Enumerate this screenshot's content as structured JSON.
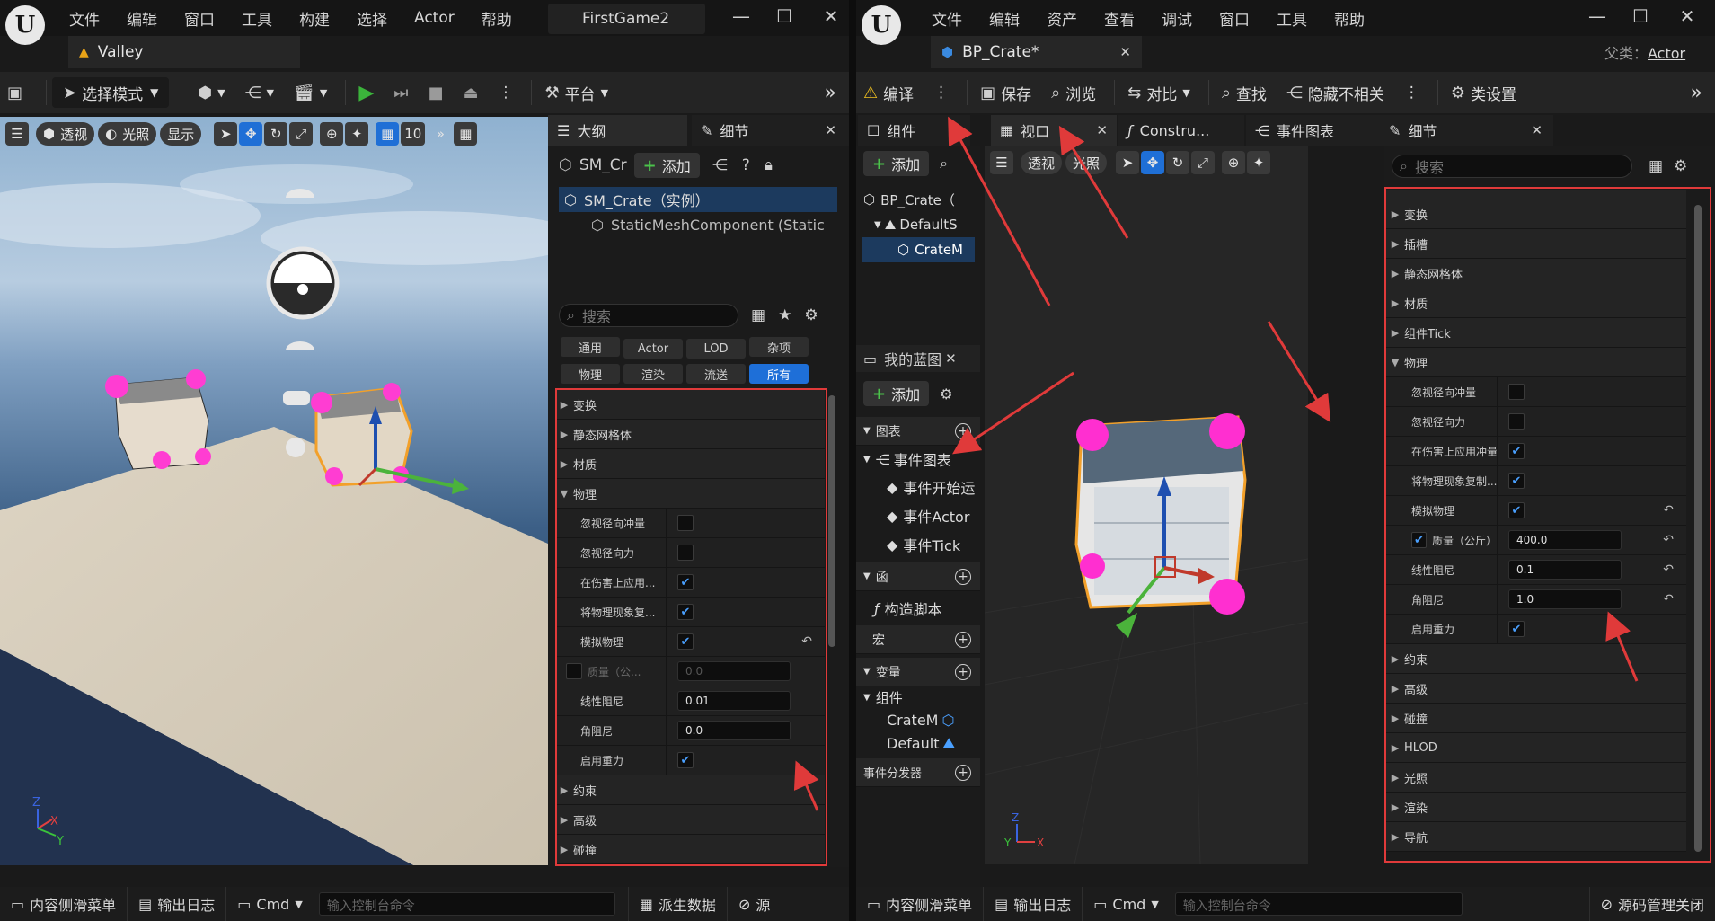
{
  "left": {
    "menu": [
      "文件",
      "编辑",
      "窗口",
      "工具",
      "构建",
      "选择",
      "Actor",
      "帮助"
    ],
    "project": "FirstGame2",
    "level_tab": "Valley",
    "toolbar": {
      "select_mode": "选择模式",
      "platform": "平台"
    },
    "viewport": {
      "perspective": "透视",
      "lit": "光照",
      "show": "显示",
      "grid_snap": "10"
    },
    "outliner": {
      "title": "大纲",
      "actor_short": "SM_Cr",
      "add": "添加",
      "items": [
        "SM_Crate（实例）",
        "StaticMeshComponent (Static"
      ]
    },
    "details": {
      "title": "细节",
      "search_placeholder": "搜索",
      "filters_row1": [
        "通用",
        "Actor",
        "LOD",
        "杂项"
      ],
      "filters_row2": [
        "物理",
        "渲染",
        "流送",
        "所有"
      ],
      "sections_top": [
        "变换",
        "静态网格体",
        "材质"
      ],
      "physics": "物理",
      "props": [
        {
          "label": "忽视径向冲量",
          "checked": false
        },
        {
          "label": "忽视径向力",
          "checked": false
        },
        {
          "label": "在伤害上应用...",
          "checked": true
        },
        {
          "label": "将物理现象复...",
          "checked": true
        },
        {
          "label": "模拟物理",
          "checked": true
        }
      ],
      "mass_label": "质量（公...",
      "mass_value": "0.0",
      "linear_label": "线性阻尼",
      "linear_value": "0.01",
      "angular_label": "角阻尼",
      "angular_value": "0.0",
      "gravity_label": "启用重力",
      "sections_bottom": [
        "约束",
        "高级",
        "碰撞"
      ]
    },
    "status": {
      "content": "内容侧滑菜单",
      "output": "输出日志",
      "cmd": "Cmd",
      "cmd_placeholder": "输入控制台命令",
      "derived": "派生数据",
      "source": "源"
    }
  },
  "right": {
    "menu": [
      "文件",
      "编辑",
      "资产",
      "查看",
      "调试",
      "窗口",
      "工具",
      "帮助"
    ],
    "bp_tab": "BP_Crate*",
    "parent_label": "父类：",
    "parent_value": "Actor",
    "toolbar": {
      "compile": "编译",
      "save": "保存",
      "browse": "浏览",
      "diff": "对比",
      "find": "查找",
      "hide": "隐藏不相关",
      "class_settings": "类设置"
    },
    "tabs": {
      "components": "组件",
      "viewport": "视口",
      "construction": "Constru...",
      "event_graph": "事件图表",
      "details": "细节"
    },
    "components": {
      "add": "添加",
      "items": [
        "BP_Crate（",
        "DefaultS",
        "CrateM"
      ]
    },
    "mybp": {
      "title": "我的蓝图",
      "add": "添加",
      "graphs": "图表",
      "event_graph": "事件图表",
      "events": [
        "事件开始运",
        "事件Actor",
        "事件Tick"
      ],
      "functions": "函",
      "construct": "构造脚本",
      "macros": "宏",
      "variables": "变量",
      "comp_group": "组件",
      "comp_items": [
        "CrateM",
        "Default"
      ],
      "dispatchers": "事件分发器"
    },
    "viewport": {
      "perspective": "透视",
      "lit": "光照"
    },
    "details": {
      "search_placeholder": "搜索",
      "sections_top": [
        "变换",
        "插槽",
        "静态网格体",
        "材质",
        "组件Tick"
      ],
      "physics": "物理",
      "props": [
        {
          "label": "忽视径向冲量",
          "checked": false
        },
        {
          "label": "忽视径向力",
          "checked": false
        },
        {
          "label": "在伤害上应用冲量",
          "checked": true
        },
        {
          "label": "将物理现象复制...",
          "checked": true
        },
        {
          "label": "模拟物理",
          "checked": true
        }
      ],
      "mass_label": "质量（公斤）",
      "mass_value": "400.0",
      "linear_label": "线性阻尼",
      "linear_value": "0.1",
      "angular_label": "角阻尼",
      "angular_value": "1.0",
      "gravity_label": "启用重力",
      "sections_bottom": [
        "约束",
        "高级",
        "碰撞",
        "HLOD",
        "光照",
        "渲染",
        "导航"
      ]
    },
    "status": {
      "content": "内容侧滑菜单",
      "output": "输出日志",
      "cmd": "Cmd",
      "cmd_placeholder": "输入控制台命令",
      "source": "源码管理关闭"
    }
  },
  "colors": {
    "annotation": "#e03a3a",
    "accent": "#1e6fd8",
    "play": "#3bb33b"
  }
}
